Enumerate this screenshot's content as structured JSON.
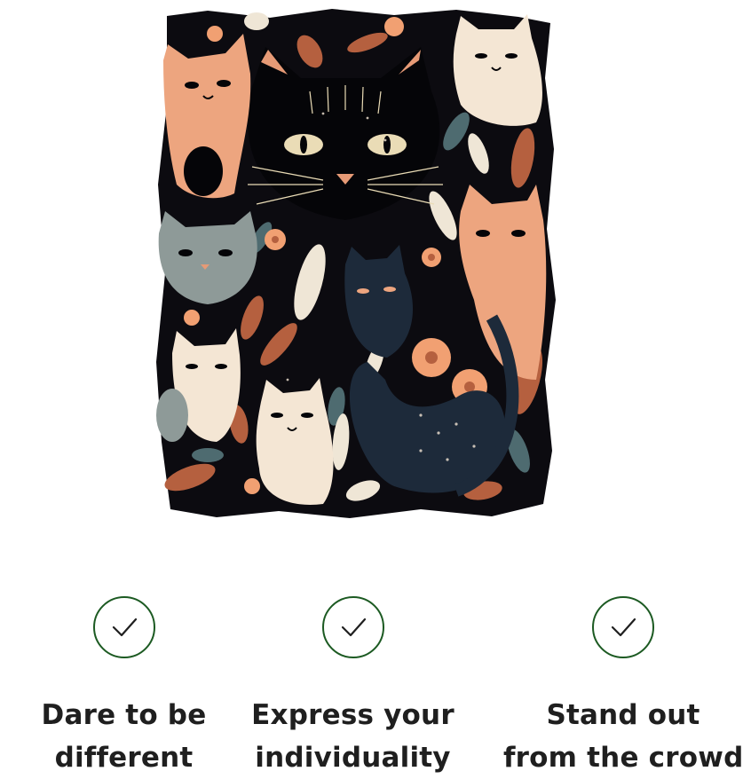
{
  "artwork": {
    "subject": "folk-art-cats-illustration",
    "colors": {
      "background": "#0c0b10",
      "orange_cat": "#eda57f",
      "cream_cat": "#f4e6d4",
      "gray_cat": "#8e9a98",
      "navy_cat": "#1d2a3a",
      "leaf_rust": "#b5603f",
      "leaf_teal": "#4e6b70",
      "flower_peach": "#f1a072"
    }
  },
  "features": [
    {
      "icon": "checkmark-icon",
      "line1": "Dare to be",
      "line2": "different"
    },
    {
      "icon": "checkmark-icon",
      "line1": "Express your",
      "line2": "individuality"
    },
    {
      "icon": "checkmark-icon",
      "line1": "Stand out",
      "line2": "from the crowd"
    }
  ],
  "colors": {
    "check_stroke": "#1c5a22",
    "text": "#1f1f1f"
  }
}
